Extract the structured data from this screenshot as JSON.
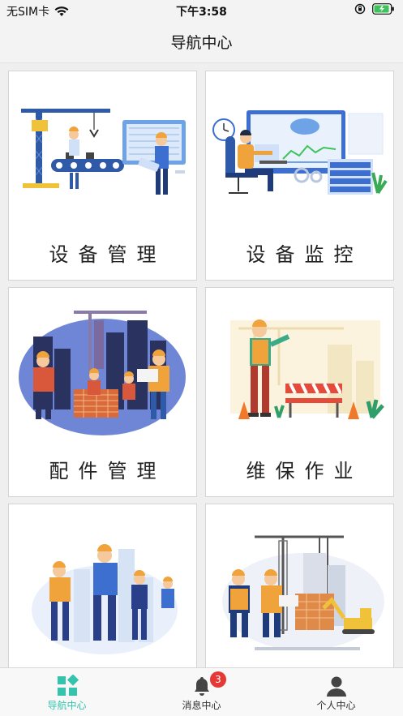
{
  "status_bar": {
    "carrier": "无SIM卡",
    "time": "下午3:58"
  },
  "nav": {
    "title": "导航中心"
  },
  "cards": [
    {
      "label": "设备管理",
      "icon": "equipment-management-illustration"
    },
    {
      "label": "设备监控",
      "icon": "equipment-monitoring-illustration"
    },
    {
      "label": "配件管理",
      "icon": "parts-management-illustration"
    },
    {
      "label": "维保作业",
      "icon": "maintenance-work-illustration"
    },
    {
      "label": "",
      "icon": "workers-illustration"
    },
    {
      "label": "",
      "icon": "construction-site-illustration"
    }
  ],
  "tab_bar": {
    "tabs": [
      {
        "label": "导航中心",
        "icon": "grid-icon",
        "active": true
      },
      {
        "label": "消息中心",
        "icon": "bell-icon",
        "badge": "3"
      },
      {
        "label": "个人中心",
        "icon": "person-icon"
      }
    ]
  },
  "colors": {
    "accent": "#34c4ad",
    "badge": "#e53935",
    "worker_orange": "#f0a33a",
    "worker_blue": "#2f5aa8"
  }
}
